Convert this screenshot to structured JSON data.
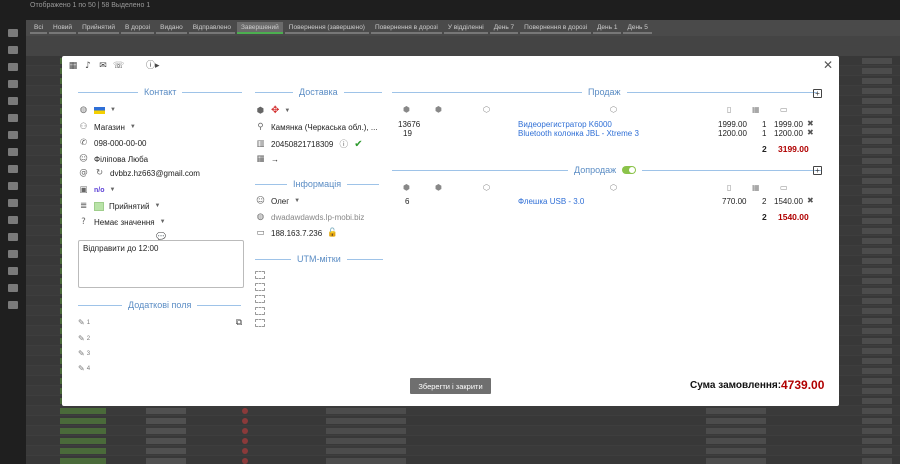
{
  "background": {
    "title": "Отображено 1 по 50 | 58 Выделено 1",
    "tabs": [
      "Всі",
      "Новий",
      "Прийнятий",
      "В дорозі",
      "Видано",
      "Відправлено",
      "Завершений",
      "Повернення (завершено)",
      "Повернення в дорозі",
      "У відділенні",
      "День 7",
      "Повернення в дорозі",
      "День 1",
      "День 5"
    ]
  },
  "toolbar": {
    "icons": [
      "calendar-icon",
      "bell-icon",
      "envelope-icon",
      "phone-icon",
      "info-icon"
    ]
  },
  "contact": {
    "section_title": "Контакт",
    "country_flag": "UA",
    "manager": "Магазин",
    "phone": "098-000-00-00",
    "name": "Філіпова Люба",
    "email": "dvbbz.hz663@gmail.com",
    "badge": "n/o",
    "status": "Прийнятий",
    "extra_status": "Немає значення",
    "comment": "Відправити до 12:00"
  },
  "extra_fields": {
    "section_title": "Додаткові поля",
    "items": [
      "1",
      "2",
      "3",
      "4"
    ]
  },
  "delivery": {
    "section_title": "Доставка",
    "city": "Камянка (Черкаська обл.), ...",
    "ttn": "20450821718309",
    "arrow": "→"
  },
  "info": {
    "section_title": "Інформація",
    "user": "Олег",
    "site": "dwadawdawds.lp-mobi.biz",
    "ip": "188.163.7.236"
  },
  "utm": {
    "section_title": "UTM-мітки"
  },
  "sale": {
    "section_title": "Продаж",
    "items": [
      {
        "id": "13676",
        "name": "Видеорегистратор K6000",
        "price": "1999.00",
        "qty": "1",
        "sum": "1999.00"
      },
      {
        "id": "19",
        "name": "Bluetooth колонка JBL - Xtreme 3",
        "price": "1200.00",
        "qty": "1",
        "sum": "1200.00"
      }
    ],
    "total_qty": "2",
    "total_sum": "3199.00"
  },
  "upsale": {
    "section_title": "Допродаж",
    "items": [
      {
        "id": "6",
        "name": "Флешка USB - 3.0",
        "price": "770.00",
        "qty": "2",
        "sum": "1540.00"
      }
    ],
    "total_qty": "2",
    "total_sum": "1540.00"
  },
  "footer": {
    "save_label": "Зберегти і закрити",
    "sum_label": "Сума замовлення:",
    "sum_value": "4739.00"
  }
}
